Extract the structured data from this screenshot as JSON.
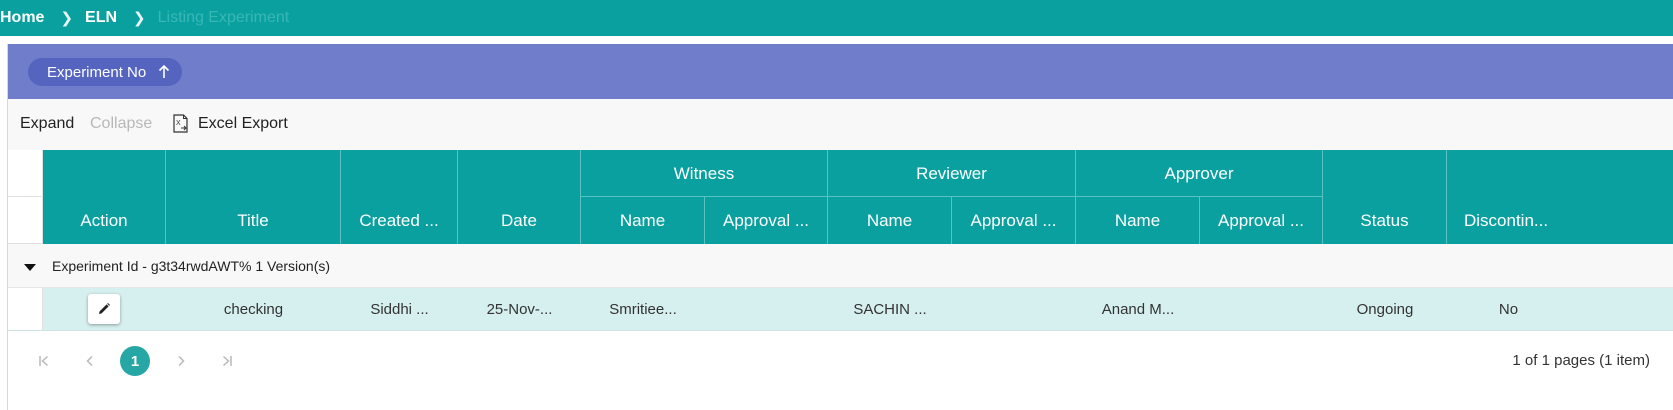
{
  "breadcrumb": {
    "home": "Home",
    "section": "ELN",
    "current": "Listing Experiment"
  },
  "grouping": {
    "chip_label": "Experiment No"
  },
  "toolbar": {
    "expand": "Expand",
    "collapse": "Collapse",
    "excel_export": "Excel Export"
  },
  "columns": {
    "action": "Action",
    "title": "Title",
    "created": "Created ...",
    "date": "Date",
    "witness": {
      "label": "Witness",
      "name": "Name",
      "approval": "Approval ..."
    },
    "reviewer": {
      "label": "Reviewer",
      "name": "Name",
      "approval": "Approval ..."
    },
    "approver": {
      "label": "Approver",
      "name": "Name",
      "approval": "Approval ..."
    },
    "status": "Status",
    "discontinued": "Discontin..."
  },
  "group_row": {
    "text": "Experiment Id - g3t34rwdAWT%  1 Version(s)"
  },
  "rows": [
    {
      "title": "checking",
      "created": "Siddhi ...",
      "date": "25-Nov-...",
      "witness_name": "Smritiee...",
      "witness_approval": "",
      "reviewer_name": "SACHIN ...",
      "reviewer_approval": "",
      "approver_name": "Anand M...",
      "approver_approval": "",
      "status": "Ongoing",
      "discontinued": "No"
    }
  ],
  "pager": {
    "current_page": "1",
    "info": "1 of 1 pages (1 item)"
  },
  "colors": {
    "teal": "#0aa0a0",
    "group_bar": "#6f7dcb",
    "chip": "#5564bf",
    "row_highlight": "#d6efef"
  }
}
